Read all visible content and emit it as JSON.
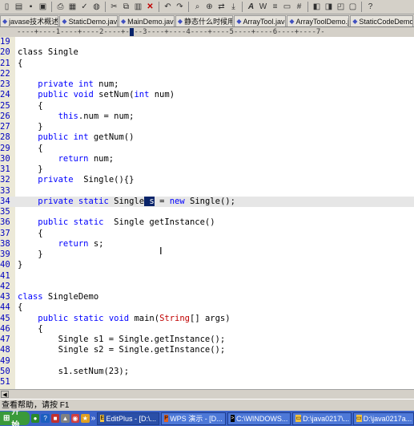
{
  "toolbar": {
    "buttons": [
      "new-file",
      "open",
      "save",
      "save-all",
      "print",
      "print-preview",
      "spell",
      "browser",
      "cut",
      "copy",
      "paste",
      "delete",
      "undo",
      "redo",
      "find",
      "find-in-files",
      "replace",
      "goto",
      "font",
      "word-wrap",
      "whitespace",
      "ruler",
      "line-number",
      "column-select",
      "directory",
      "cliptext",
      "fullscreen",
      "help"
    ]
  },
  "tabs": [
    {
      "label": "javase技术概述.j"
    },
    {
      "label": "StaticDemo.java"
    },
    {
      "label": "MainDemo.java"
    },
    {
      "label": "静态什么时候用."
    },
    {
      "label": "ArrayTool.java"
    },
    {
      "label": "ArrayToolDemo.ja"
    },
    {
      "label": "StaticCodeDemo.j"
    }
  ],
  "ruler": {
    "text": "----+----1----+----2----+-",
    "mark": "-",
    "rest": "--3----+----4----+----5----+----6----+----7-"
  },
  "code": {
    "l19": {
      "n": "19"
    },
    "l20": {
      "n": "20",
      "a": "class Single"
    },
    "l21": {
      "n": "21",
      "a": "{"
    },
    "l22": {
      "n": "22"
    },
    "l23": {
      "n": "23",
      "pre": "    ",
      "kw1": "private",
      "sp": " ",
      "kw2": "int",
      "rest": " num;"
    },
    "l24": {
      "n": "24",
      "pre": "    ",
      "kw1": "public",
      "sp": " ",
      "kw2": "void",
      "mid": " setNum(",
      "kw3": "int",
      "rest": " num)"
    },
    "l25": {
      "n": "25",
      "a": "    {"
    },
    "l26": {
      "n": "26",
      "pre": "        ",
      "kw1": "this",
      "rest": ".num = num;"
    },
    "l27": {
      "n": "27",
      "a": "    }"
    },
    "l28": {
      "n": "28",
      "pre": "    ",
      "kw1": "public",
      "sp": " ",
      "kw2": "int",
      "rest": " getNum()"
    },
    "l29": {
      "n": "29",
      "a": "    {"
    },
    "l30": {
      "n": "30",
      "pre": "        ",
      "kw1": "return",
      "rest": " num;"
    },
    "l31": {
      "n": "31",
      "a": "    }"
    },
    "l32": {
      "n": "32",
      "pre": "    ",
      "kw1": "private",
      "rest": "  Single(){}"
    },
    "l33": {
      "n": "33"
    },
    "l34": {
      "n": "34",
      "pre": "    ",
      "kw1": "private",
      "sp": " ",
      "kw2": "static",
      "mid": " Single",
      "sel": " s",
      "mid2": " = ",
      "kw3": "new",
      "rest": " Single();"
    },
    "l35": {
      "n": "35"
    },
    "l36": {
      "n": "36",
      "pre": "    ",
      "kw1": "public",
      "sp": " ",
      "kw2": "static",
      "rest": "  Single getInstance()"
    },
    "l37": {
      "n": "37",
      "a": "    {"
    },
    "l38": {
      "n": "38",
      "pre": "        ",
      "kw1": "return",
      "rest": " s;"
    },
    "l39": {
      "n": "39",
      "a": "    }"
    },
    "l40": {
      "n": "40",
      "a": "}"
    },
    "l41": {
      "n": "41"
    },
    "l42": {
      "n": "42"
    },
    "l43": {
      "n": "43",
      "pre": "",
      "kw1": "class",
      "rest": " SingleDemo"
    },
    "l44": {
      "n": "44",
      "a": "{"
    },
    "l45": {
      "n": "45",
      "pre": "    ",
      "kw1": "public",
      "sp": " ",
      "kw2": "static",
      "sp2": " ",
      "kw3": "void",
      "mid": " main(",
      "ty": "String",
      "rest": "[] args)"
    },
    "l46": {
      "n": "46",
      "a": "    {"
    },
    "l47": {
      "n": "47",
      "a": "        Single s1 = Single.getInstance();"
    },
    "l48": {
      "n": "48",
      "a": "        Single s2 = Single.getInstance();"
    },
    "l49": {
      "n": "49"
    },
    "l50": {
      "n": "50",
      "a": "        s1.setNum(23);"
    },
    "l51": {
      "n": "51"
    }
  },
  "status": {
    "text": "查看帮助，请按 F1"
  },
  "taskbar": {
    "start": "开始",
    "more": "»",
    "tasks": [
      {
        "label": "EditPlus - [D:\\..."
      },
      {
        "label": "WPS 演示 - [D..."
      },
      {
        "label": "C:\\WINDOWS..."
      },
      {
        "label": "D:\\java0217\\..."
      },
      {
        "label": "D:\\java0217a..."
      }
    ]
  },
  "colors": {
    "keyword": "#0000ff",
    "type": "#c00000",
    "linenumber": "#0000c0",
    "selection": "#0a246a",
    "taskbar": "#3b63c8"
  }
}
